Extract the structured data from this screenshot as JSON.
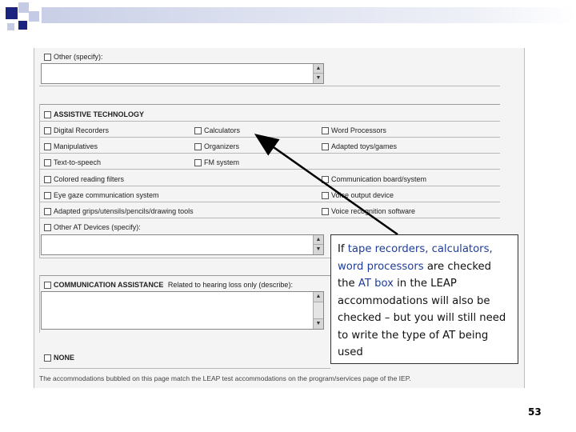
{
  "form": {
    "other_specify": "Other (specify):",
    "at_heading": "ASSISTIVE TECHNOLOGY",
    "at_items": [
      "Digital Recorders",
      "Calculators",
      "Word Processors",
      "Manipulatives",
      "Organizers",
      "Adapted toys/games",
      "Text-to-speech",
      "FM system",
      "Colored reading filters",
      "Communication board/system",
      "Eye gaze communication system",
      "Voice output device",
      "Adapted grips/utensils/pencils/drawing tools",
      "Voice recognition software",
      "Other AT Devices (specify):"
    ],
    "comm_heading": "COMMUNICATION ASSISTANCE",
    "comm_suffix": "Related to hearing loss only (describe):",
    "none_label": "NONE",
    "footer_note": "The accommodations bubbled on this page match the LEAP test accommodations on the program/services page of the IEP."
  },
  "callout": {
    "t1": "If ",
    "h1": "tape recorders, calculators, word processors",
    "t2": " are checked the ",
    "h2": "AT box",
    "t3": " in the LEAP accommodations will also be checked – but you will still need to write the type of AT being used"
  },
  "page_number": "53",
  "colors": {
    "accent_blue": "#1f3d99",
    "header_navy": "#1a237e"
  }
}
